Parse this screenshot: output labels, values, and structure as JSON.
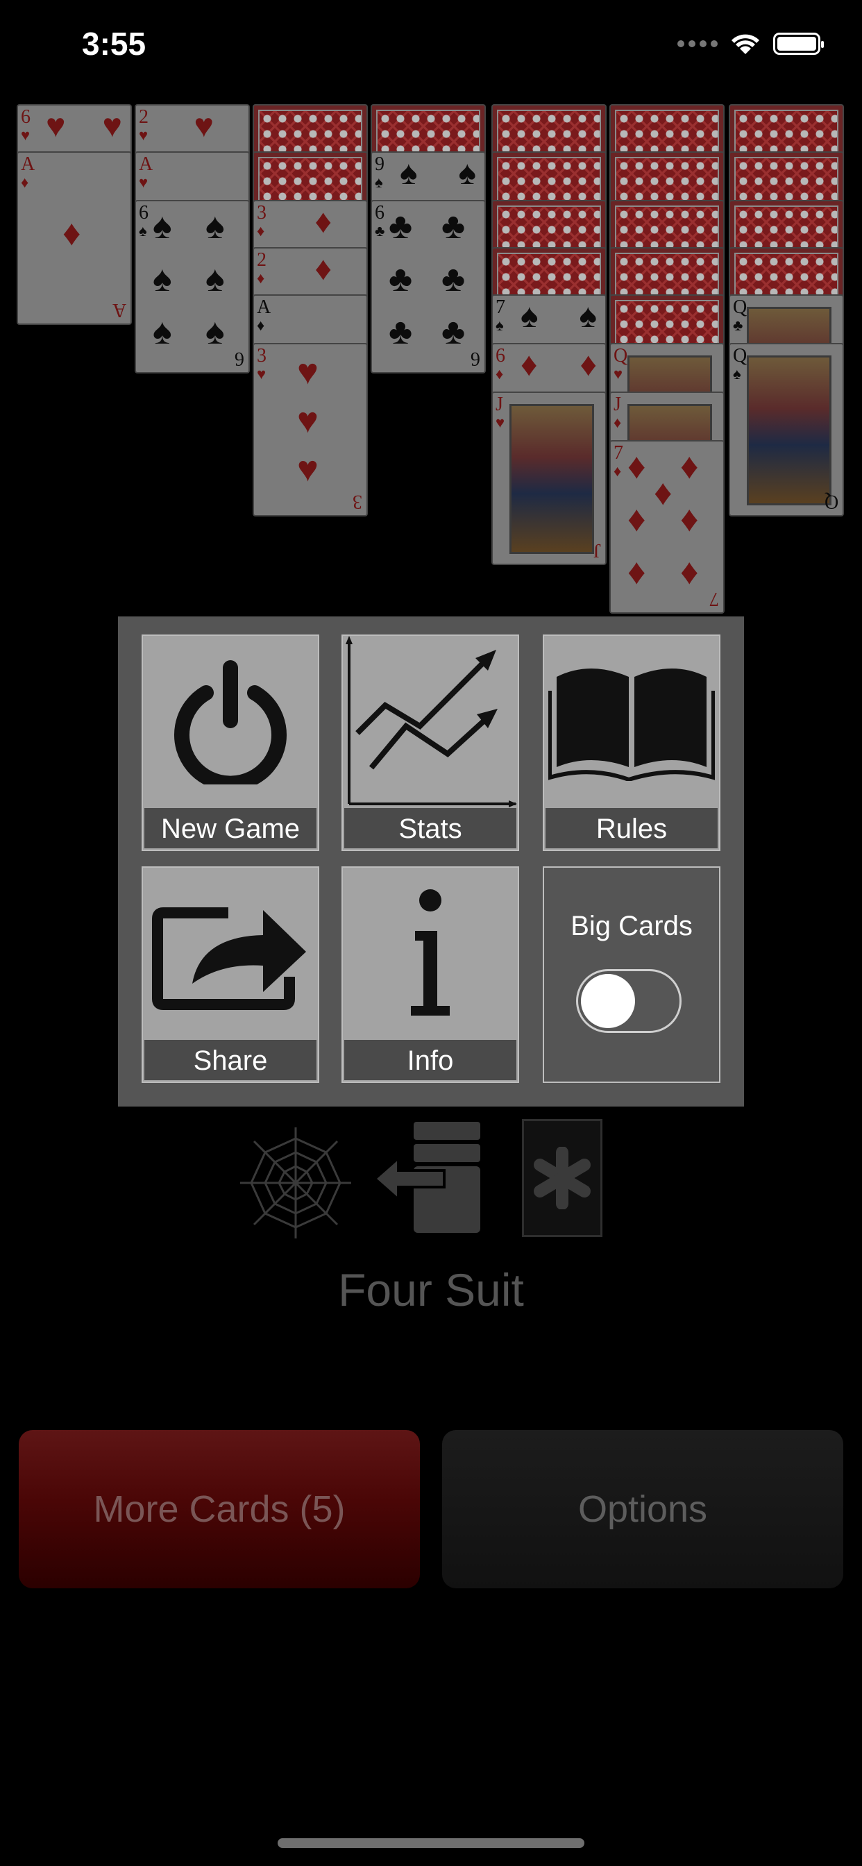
{
  "status_bar": {
    "time": "3:55"
  },
  "tableau": {
    "columns": [
      {
        "cards": [
          "6♥",
          "A♦"
        ]
      },
      {
        "cards": [
          "2♥",
          "A♥",
          "6♠"
        ]
      },
      {
        "cards": [
          "back",
          "back",
          "3♦",
          "2♦",
          "A♦",
          "3♥"
        ]
      },
      {
        "cards": [
          "back",
          "9♠",
          "6♣"
        ]
      },
      {
        "cards": [
          "back",
          "back",
          "back",
          "back",
          "7♠",
          "6♦",
          "J♥"
        ]
      },
      {
        "cards": [
          "back",
          "back",
          "back",
          "back",
          "back",
          "Q♥",
          "J♦",
          "7♦"
        ]
      },
      {
        "cards": [
          "back",
          "back",
          "back",
          "back",
          "Q♣",
          "Q♠"
        ]
      }
    ]
  },
  "menu": {
    "new_game": "New Game",
    "stats": "Stats",
    "rules": "Rules",
    "share": "Share",
    "info": "Info",
    "big_cards": "Big Cards",
    "big_cards_on": false
  },
  "mode": {
    "label": "Four Suit",
    "icons": [
      "spider-web-icon",
      "undo-stack-icon",
      "asterisk-card-icon"
    ]
  },
  "buttons": {
    "more_cards": "More Cards (5)",
    "options": "Options"
  }
}
